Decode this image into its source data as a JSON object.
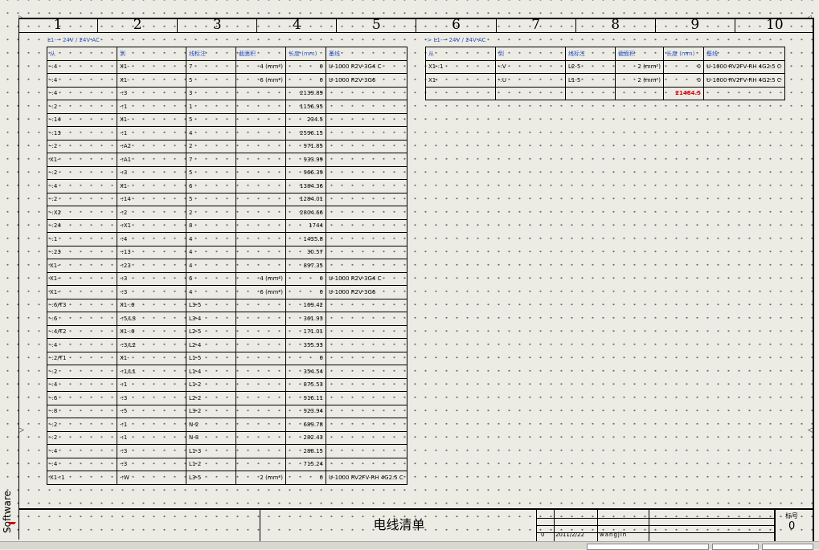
{
  "columns": [
    "1",
    "2",
    "3",
    "4",
    "5",
    "6",
    "7",
    "8",
    "9",
    "10"
  ],
  "left_table": {
    "title": "L1-~ 24V / 24V AC",
    "headers": [
      "从",
      "到",
      "线标注",
      "截面积",
      "长度 (mm)",
      "基线"
    ],
    "rows": [
      [
        "-:4",
        "X1-",
        "7",
        "4 (mm²)",
        "0",
        "U-1000 R2V 3G4 C"
      ],
      [
        "-:4",
        "X1-",
        "5",
        "6 (mm²)",
        "0",
        "U-1000 R2V 3G6"
      ],
      [
        "-:4",
        "-:3",
        "3",
        "",
        "2139.89",
        ""
      ],
      [
        "-:2",
        "-:1",
        "1",
        "",
        "1156.95",
        ""
      ],
      [
        "-:14",
        "X1-",
        "5",
        "",
        "234.5",
        ""
      ],
      [
        "-:13",
        "-:1",
        "4",
        "",
        "2596.15",
        ""
      ],
      [
        "-:2",
        "-:A2",
        "2",
        "",
        "971.85",
        ""
      ],
      [
        "X1-",
        "-:A1",
        "7",
        "",
        "933.99",
        ""
      ],
      [
        "-:2",
        "-:3",
        "5",
        "",
        "966.39",
        ""
      ],
      [
        "-:4",
        "X1-",
        "6",
        "",
        "1384.36",
        ""
      ],
      [
        "-:2",
        "-:14",
        "5",
        "",
        "1284.01",
        ""
      ],
      [
        "-:X2",
        "-:2",
        "2",
        "",
        "2804.66",
        ""
      ],
      [
        "-:24",
        "-:X1",
        "8",
        "",
        "1744",
        ""
      ],
      [
        "-:1",
        "-:4",
        "4",
        "",
        "1435.8",
        ""
      ],
      [
        "-:23",
        "-:13",
        "4",
        "",
        "30.57",
        ""
      ],
      [
        "X1-",
        "-:23",
        "4",
        "",
        "897.35",
        ""
      ],
      [
        "X1-",
        "-:3",
        "6",
        "4 (mm²)",
        "0",
        "U-1000 R2V 3G4 C"
      ],
      [
        "X1-",
        "-:3",
        "4",
        "6 (mm²)",
        "0",
        "U-1000 R2V 3G6"
      ],
      [
        "-:6/T3",
        "X1-:0",
        "L3-5",
        "",
        "169.42",
        ""
      ],
      [
        "-:6",
        "-:5/L3",
        "L3-4",
        "",
        "361.93",
        ""
      ],
      [
        "-:4/T2",
        "X1-:0",
        "L2-5",
        "",
        "171.01",
        ""
      ],
      [
        "-:4",
        "-:3/L2",
        "L2-4",
        "",
        "355.93",
        ""
      ],
      [
        "-:2/T1",
        "X1-",
        "L1-5",
        "",
        "0",
        ""
      ],
      [
        "-:2",
        "-:1/L1",
        "L1-4",
        "",
        "354.54",
        ""
      ],
      [
        "-:4",
        "-:1",
        "L1-2",
        "",
        "875.53",
        ""
      ],
      [
        "-:6",
        "-:3",
        "L2-2",
        "",
        "916.11",
        ""
      ],
      [
        "-:8",
        "-:5",
        "L3-2",
        "",
        "923.94",
        ""
      ],
      [
        "-:2",
        "-:1",
        "N-2",
        "",
        "689.78",
        ""
      ],
      [
        "-:2",
        "-:1",
        "N-3",
        "",
        "282.43",
        ""
      ],
      [
        "-:4",
        "-:3",
        "L1-3",
        "",
        "288.15",
        ""
      ],
      [
        "-:4",
        "-:3",
        "L1-2",
        "",
        "715.24",
        ""
      ],
      [
        "X1-:1",
        "-:W",
        "L3-5",
        "2 (mm²)",
        "0",
        "U-1000 RV2FV-RH 4G2.5 C"
      ]
    ]
  },
  "right_table": {
    "title": "-> L1-~ 24V / 24V AC",
    "headers": [
      "从",
      "到",
      "线标注",
      "截面积",
      "长度 (mm)",
      "基线"
    ],
    "rows": [
      [
        "X1-:1",
        "-:V",
        "L2-5",
        "2 (mm²)",
        "0",
        "U-1000 RV2FV-RH 4G2.5 C"
      ],
      [
        "X1-",
        "-:U",
        "L1-5",
        "2 (mm²)",
        "0",
        "U-1000 RV2FV-RH 4G2.5 C"
      ]
    ],
    "total": "21484.5"
  },
  "titleblock": {
    "doc_title": "电线清单",
    "revision": "0",
    "date": "2011/2/22",
    "author": "wangjin",
    "sheet_label": "标号",
    "sheet_value": "0"
  },
  "brand": "Software",
  "colors": {
    "accent": "#2a55c8",
    "total": "#e00000",
    "background": "#ecebe4"
  }
}
